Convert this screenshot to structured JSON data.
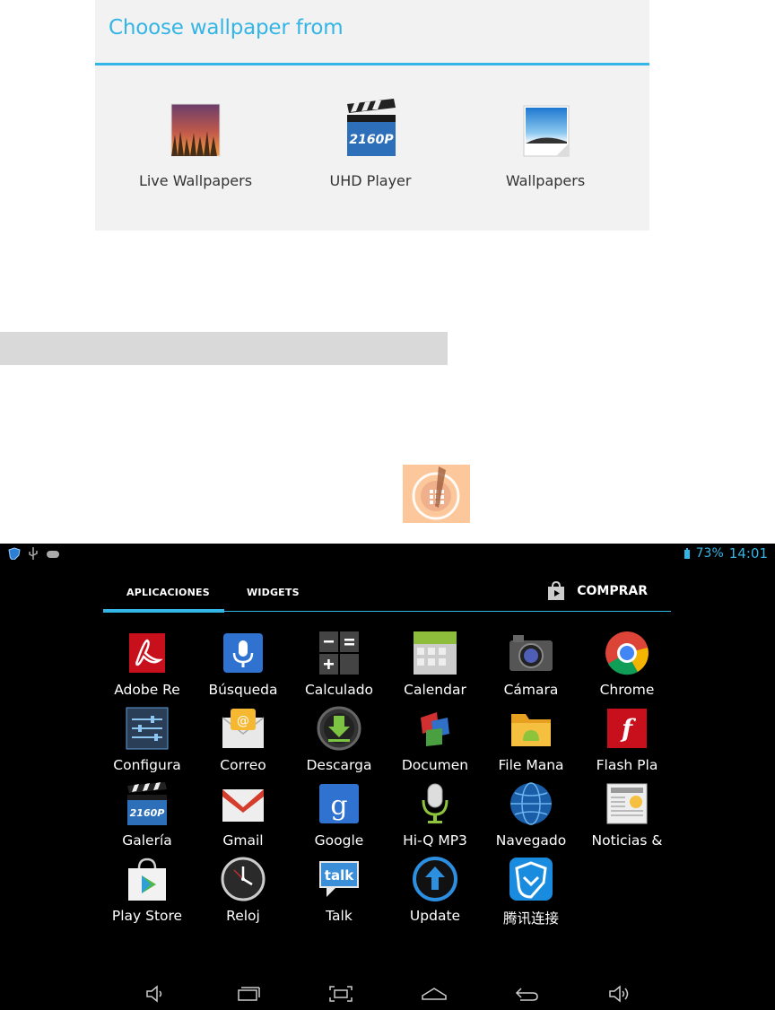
{
  "dialog": {
    "title": "Choose wallpaper from",
    "options": [
      {
        "label": "Live Wallpapers",
        "icon": "live-wallpapers-icon"
      },
      {
        "label": "UHD Player",
        "icon": "uhd-player-icon",
        "badge": "2160P"
      },
      {
        "label": "Wallpapers",
        "icon": "wallpapers-icon"
      }
    ]
  },
  "statusbar": {
    "battery": "73%",
    "time": "14:01"
  },
  "drawer": {
    "tabs": [
      "APLICACIONES",
      "WIDGETS"
    ],
    "store_label": "COMPRAR",
    "apps": [
      "Adobe Re",
      "Búsqueda",
      "Calculado",
      "Calendar",
      "Cámara",
      "Chrome",
      "Configura",
      "Correo",
      "Descarga",
      "Documen",
      "File Mana",
      "Flash Pla",
      "Galería",
      "Gmail",
      "Google",
      "Hi-Q MP3",
      "Navegado",
      "Noticias &",
      "Play Store",
      "Reloj",
      "Talk",
      "Update",
      "腾讯连接"
    ],
    "badges": {
      "galeria": "2160P",
      "talk": "talk",
      "google": "g",
      "flash": "f"
    }
  },
  "colors": {
    "accent": "#33b5e5",
    "launcher_bg": "#fbc79b",
    "dialog_bg": "#f2f2f2"
  }
}
